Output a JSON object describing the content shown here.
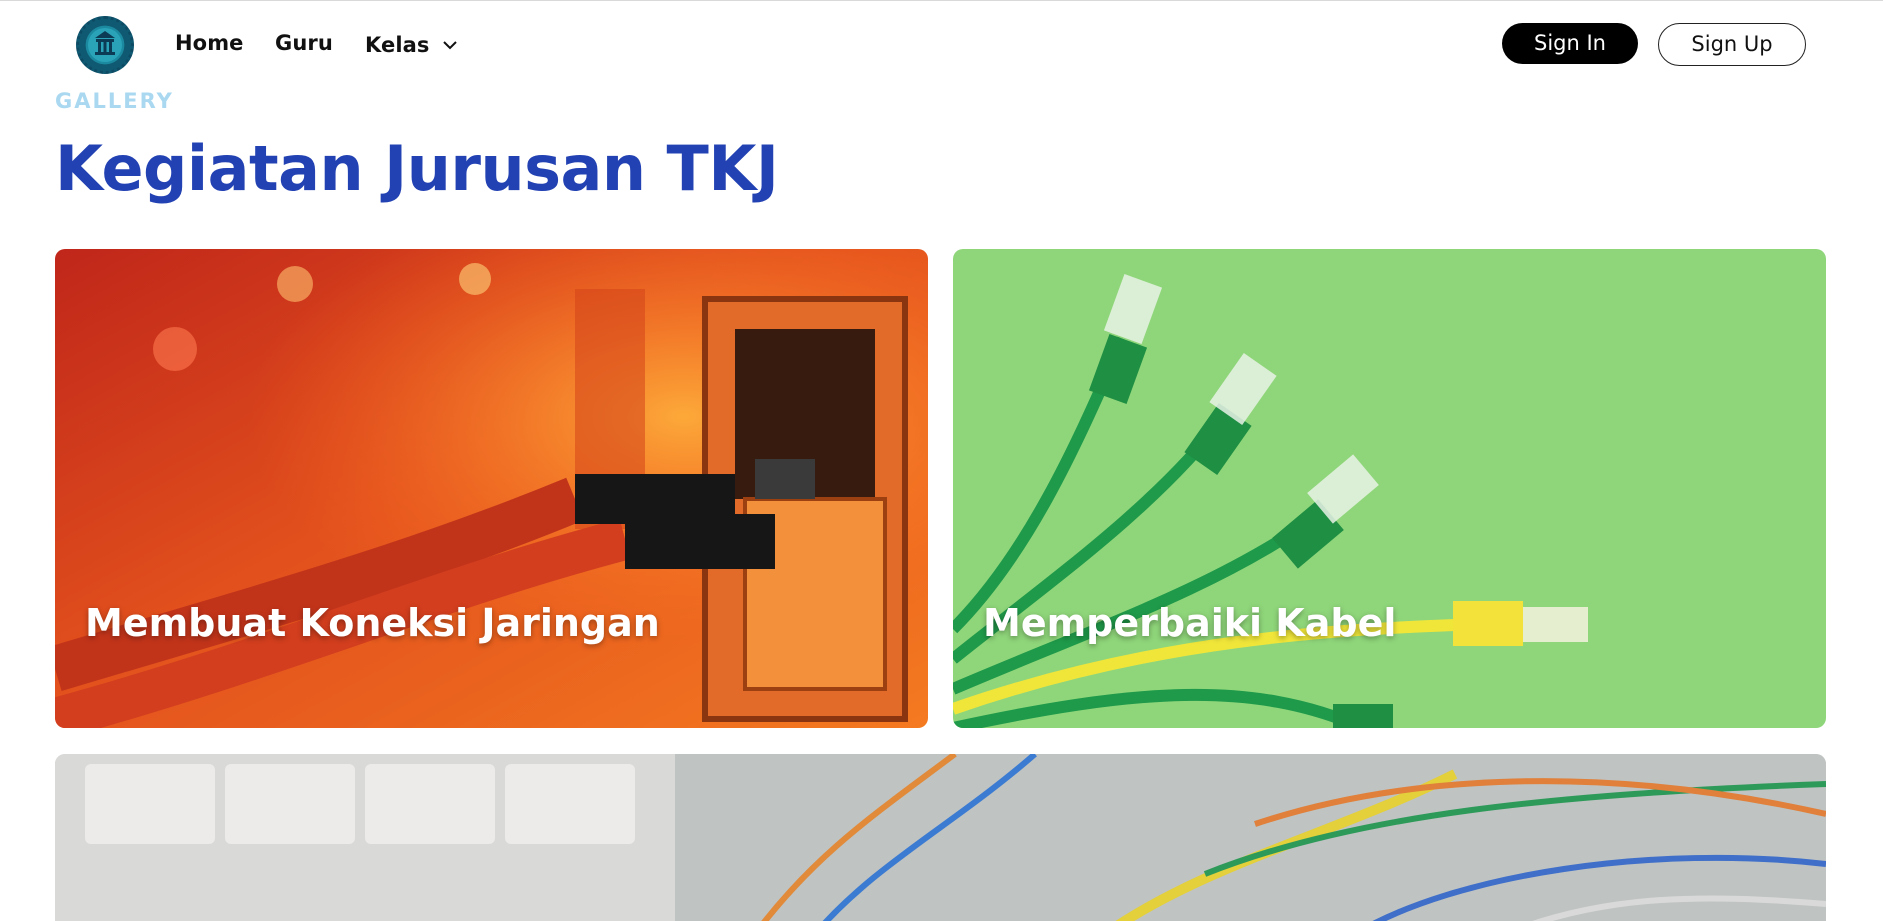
{
  "nav": {
    "logo_icon": "school-emblem-icon",
    "items": [
      "Home",
      "Guru",
      "Kelas"
    ],
    "kelas_icon": "chevron-down-icon",
    "sign_in": "Sign In",
    "sign_up": "Sign Up"
  },
  "header": {
    "eyebrow": "GALLERY",
    "title": "Kegiatan Jurusan TKJ"
  },
  "gallery": {
    "cards": [
      {
        "caption": "Membuat Koneksi Jaringan",
        "image": "orange-network-cables-photo"
      },
      {
        "caption": "Memperbaiki Kabel",
        "image": "green-yellow-ethernet-cables-photo"
      },
      {
        "caption": "",
        "image": "server-rack-wires-photo"
      }
    ]
  },
  "colors": {
    "title": "#2241b3",
    "eyebrow": "#a9d8f0",
    "signin_bg": "#000000"
  }
}
